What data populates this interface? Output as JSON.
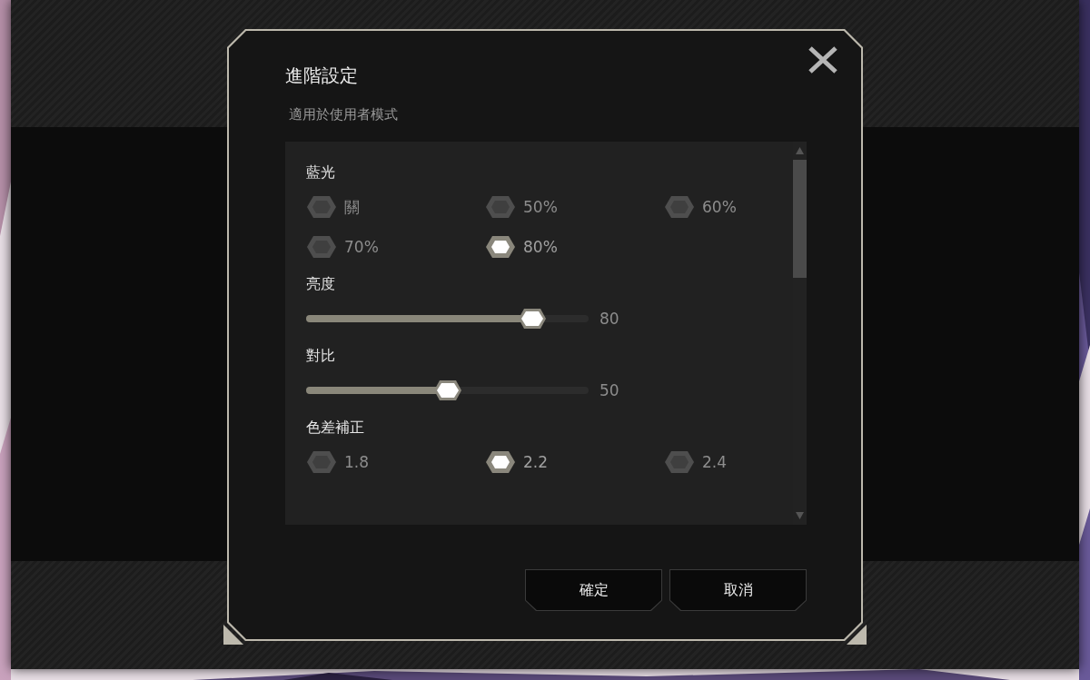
{
  "dialog": {
    "title": "進階設定",
    "subtitle": "適用於使用者模式",
    "sections": [
      {
        "kind": "options",
        "label": "藍光",
        "options": [
          {
            "label": "關",
            "selected": false
          },
          {
            "label": "50%",
            "selected": false
          },
          {
            "label": "60%",
            "selected": false
          },
          {
            "label": "70%",
            "selected": false
          },
          {
            "label": "80%",
            "selected": true
          }
        ]
      },
      {
        "kind": "slider",
        "label": "亮度",
        "level": 0.8,
        "reading": "80"
      },
      {
        "kind": "slider",
        "label": "對比",
        "level": 0.5,
        "reading": "50"
      },
      {
        "kind": "options",
        "label": "色差補正",
        "options": [
          {
            "label": "1.8",
            "selected": false
          },
          {
            "label": "2.2",
            "selected": true
          },
          {
            "label": "2.4",
            "selected": false
          }
        ]
      }
    ],
    "buttons": [
      "確定",
      "取消"
    ]
  }
}
